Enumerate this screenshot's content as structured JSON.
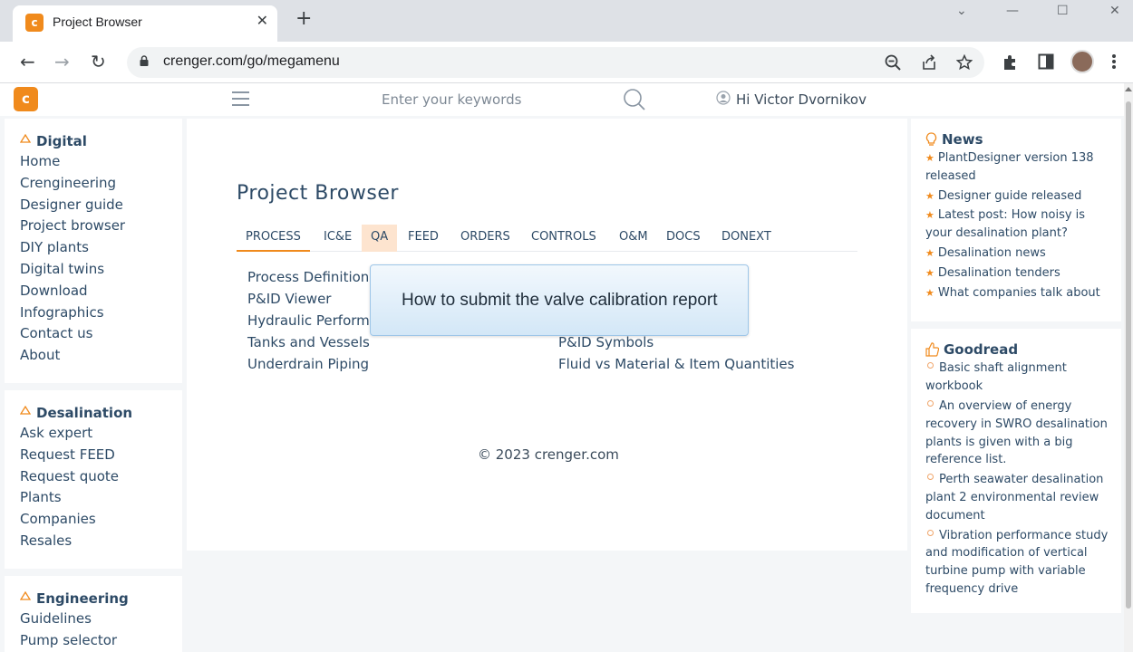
{
  "browser": {
    "tab_title": "Project Browser",
    "tab_close": "✕",
    "new_tab": "+",
    "url": "crenger.com/go/megamenu",
    "win_min": "⌄",
    "win_minimize": "—",
    "win_max": "☐",
    "win_close": "✕",
    "back": "←",
    "forward": "→",
    "reload": "↻"
  },
  "header": {
    "logo_text": "c",
    "search_placeholder": "Enter your keywords",
    "greeting": "Hi Victor Dvornikov"
  },
  "sidebar": {
    "sections": [
      {
        "title": "Digital",
        "items": [
          "Home",
          "Crengineering",
          "Designer guide",
          "Project browser",
          "DIY plants",
          "Digital twins",
          "Download",
          "Infographics",
          "Contact us",
          "About"
        ]
      },
      {
        "title": "Desalination",
        "items": [
          "Ask expert",
          "Request FEED",
          "Request quote",
          "Plants",
          "Companies",
          "Resales"
        ]
      },
      {
        "title": "Engineering",
        "items": [
          "Guidelines",
          "Pump selector"
        ]
      }
    ]
  },
  "main": {
    "title": "Project Browser",
    "tabs": [
      "PROCESS",
      "IC&E",
      "QA",
      "FEED",
      "ORDERS",
      "CONTROLS",
      "O&M",
      "DOCS",
      "DONEXT"
    ],
    "active_tab": "PROCESS",
    "hover_tab": "QA",
    "links_left": [
      "Process Definition",
      "P&ID Viewer",
      "Hydraulic Performance",
      "Tanks and Vessels",
      "Underdrain Piping"
    ],
    "links_right": [
      "P&ID Symbols",
      "Fluid vs Material & Item Quantities"
    ],
    "footer": "© 2023 crenger.com"
  },
  "tooltip": {
    "text": "How to submit the valve calibration report"
  },
  "rightbar": {
    "news": {
      "title": "News",
      "items": [
        "PlantDesigner version 138 released",
        "Designer guide released",
        "Latest post: How noisy is your desalination plant?",
        "Desalination news",
        "Desalination tenders",
        "What companies talk about"
      ]
    },
    "goodread": {
      "title": "Goodread",
      "items": [
        "Basic shaft alignment workbook",
        "An overview of energy recovery in SWRO desalination plants is given with a big reference list.",
        "Perth seawater desalination plant 2 environmental review document",
        "Vibration performance study and modification of vertical turbine pump with variable frequency drive"
      ]
    }
  },
  "colors": {
    "accent": "#f08a1c",
    "link": "#2d4a66",
    "tooltip_border": "#9ec6e8"
  }
}
